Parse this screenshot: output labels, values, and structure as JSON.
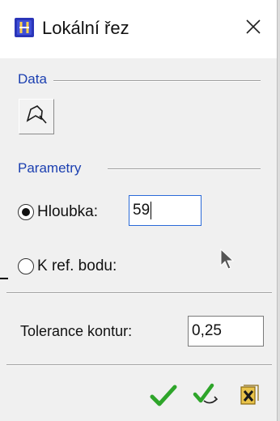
{
  "window": {
    "title": "Lokální řez",
    "app_icon": "cad-app-icon",
    "close_icon": "close-icon"
  },
  "data_section": {
    "label": "Data",
    "pick_button_icon": "select-boundary-icon"
  },
  "params_section": {
    "label": "Parametry",
    "depth_option": {
      "label": "Hloubka:",
      "value": "59",
      "selected": true
    },
    "ref_point_option": {
      "label": "K ref. bodu:",
      "selected": false
    }
  },
  "tolerance": {
    "label": "Tolerance kontur:",
    "value": "0,25"
  },
  "footer": {
    "ok_icon": "checkmark-icon",
    "apply_icon": "checkmark-apply-icon",
    "cancel_icon": "cancel-icon"
  },
  "colors": {
    "section_label": "#1b3fb0",
    "checkmark": "#2ea52a",
    "focus_border": "#2b6ad8"
  }
}
